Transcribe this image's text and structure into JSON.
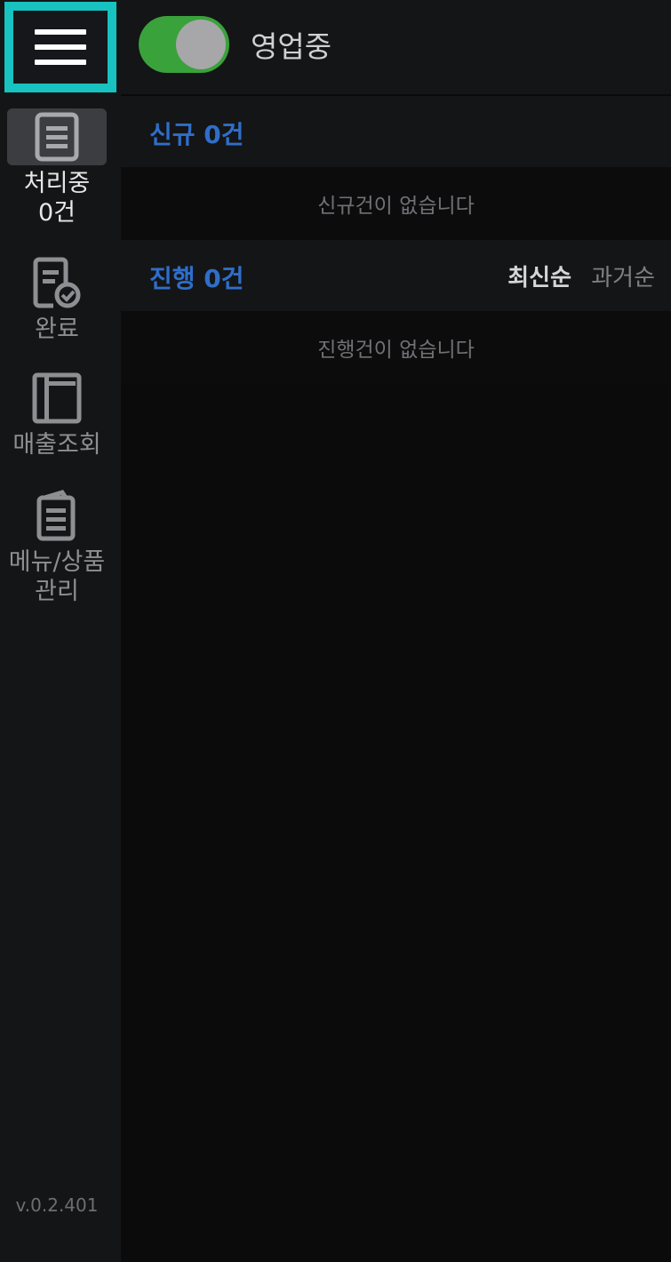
{
  "header": {
    "menu_icon": "hamburger-menu-icon",
    "open_status_label": "영업중",
    "open_toggle_on": true,
    "toggle_color": "#3aa23a",
    "highlight_color": "#17c2c0"
  },
  "sidebar": {
    "items": [
      {
        "icon": "document-list-icon",
        "label": "처리중\n0건",
        "active": true
      },
      {
        "icon": "document-check-icon",
        "label": "완료",
        "active": false
      },
      {
        "icon": "ledger-book-icon",
        "label": "매출조회",
        "active": false
      },
      {
        "icon": "notepad-icon",
        "label": "메뉴/상품\n관리",
        "active": false
      }
    ],
    "version": "v.0.2.401"
  },
  "sections": {
    "new": {
      "title": "신규 0건",
      "empty_text": "신규건이 없습니다"
    },
    "in_progress": {
      "title": "진행 0건",
      "empty_text": "진행건이 없습니다",
      "sort_latest": "최신순",
      "sort_oldest": "과거순"
    }
  },
  "colors": {
    "accent_blue": "#2f6ec9",
    "background": "#0b0b0c",
    "panel": "#141517"
  }
}
